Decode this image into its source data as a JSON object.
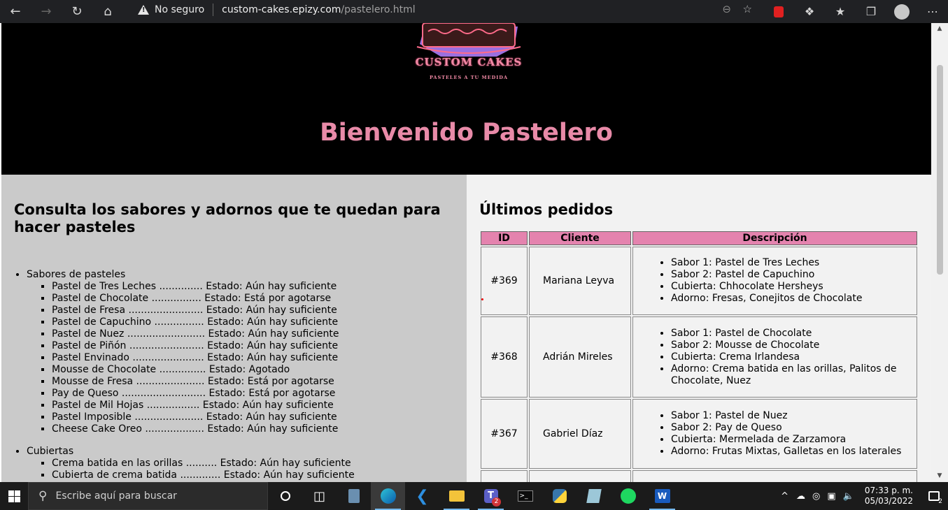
{
  "browser": {
    "security_label": "No seguro",
    "url_host": "custom-cakes.epizy.com",
    "url_path": "/pastelero.html"
  },
  "header": {
    "logo_title": "CUSTOM CAKES",
    "logo_subtitle": "PASTELES A TU MEDIDA",
    "welcome": "Bienvenido Pastelero"
  },
  "inventory": {
    "title": "Consulta los sabores y adornos que te quedan para hacer pasteles",
    "categories": [
      {
        "name": "Sabores de pasteles",
        "items": [
          "Pastel de Tres Leches .............. Estado: Aún hay suficiente",
          "Pastel de Chocolate ................ Estado: Está por agotarse",
          "Pastel de Fresa ........................ Estado: Aún hay suficiente",
          "Pastel de Capuchino ................ Estado: Aún hay suficiente",
          "Pastel de Nuez ......................... Estado: Aún hay suficiente",
          "Pastel de Piñón ........................ Estado: Aún hay suficiente",
          "Pastel Envinado ....................... Estado: Aún hay suficiente",
          "Mousse de Chocolate ............... Estado: Agotado",
          "Mousse de Fresa ...................... Estado: Está por agotarse",
          "Pay de Queso ........................... Estado: Está por agotarse",
          "Pastel de Mil Hojas ................. Estado: Aún hay suficiente",
          "Pastel Imposible ...................... Estado: Aún hay suficiente",
          "Cheese Cake Oreo ................... Estado: Aún hay suficiente"
        ]
      },
      {
        "name": "Cubiertas",
        "items": [
          "Crema batida en las orillas .......... Estado: Aún hay suficiente",
          "Cubierta de crema batida ............. Estado: Aún hay suficiente"
        ]
      }
    ]
  },
  "orders": {
    "title": "Últimos pedidos",
    "columns": [
      "ID",
      "Cliente",
      "Descripción"
    ],
    "rows": [
      {
        "id": "#369",
        "client": "Mariana Leyva",
        "details": [
          "Sabor 1: Pastel de Tres Leches",
          "Sabor 2: Pastel de Capuchino",
          "Cubierta: Chhocolate Hersheys",
          "Adorno: Fresas, Conejitos de Chocolate"
        ]
      },
      {
        "id": "#368",
        "client": "Adrián Mireles",
        "details": [
          "Sabor 1: Pastel de Chocolate",
          "Sabor 2: Mousse de Chocolate",
          "Cubierta: Crema Irlandesa",
          "Adorno: Crema batida en las orillas, Palitos de Chocolate, Nuez"
        ]
      },
      {
        "id": "#367",
        "client": "Gabriel Díaz",
        "details": [
          "Sabor 1: Pastel de Nuez",
          "Sabor 2: Pay de Queso",
          "Cubierta: Mermelada de Zarzamora",
          "Adorno: Frutas Mixtas, Galletas en los laterales"
        ]
      }
    ]
  },
  "taskbar": {
    "search_placeholder": "Escribe aquí para buscar",
    "time": "07:33 p. m.",
    "date": "05/03/2022",
    "teams_badge": "2",
    "notification_count": "2"
  },
  "colors": {
    "accent_pink": "#e88aa8",
    "table_header": "#e483ae",
    "left_panel": "#cacaca",
    "right_panel": "#f2f2f2"
  }
}
